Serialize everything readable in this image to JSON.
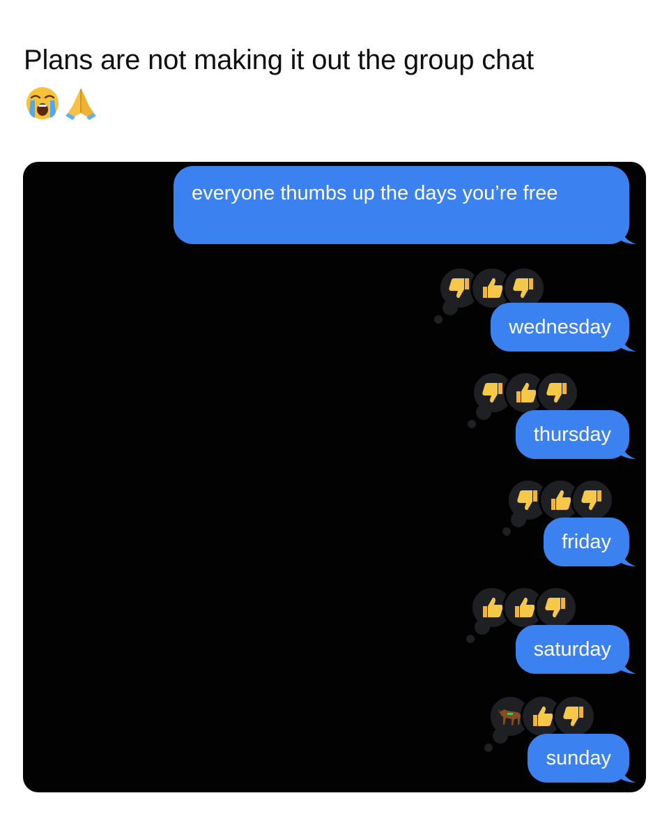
{
  "post": {
    "title": "Plans are not making it out the group chat",
    "title_emojis": [
      "loudly-crying-face-icon",
      "folded-hands-icon"
    ]
  },
  "chat": {
    "background": "#020203",
    "bubble_color": "#3b82f0",
    "question": {
      "text": "everyone thumbs up the days you’re free"
    },
    "days": [
      {
        "label": "wednesday",
        "reactions": [
          "thumbs-down",
          "thumbs-up",
          "thumbs-down"
        ]
      },
      {
        "label": "thursday",
        "reactions": [
          "thumbs-down",
          "thumbs-up",
          "thumbs-down"
        ]
      },
      {
        "label": "friday",
        "reactions": [
          "thumbs-down",
          "thumbs-up",
          "thumbs-down"
        ]
      },
      {
        "label": "saturday",
        "reactions": [
          "thumbs-up",
          "thumbs-up",
          "thumbs-down"
        ]
      },
      {
        "label": "sunday",
        "reactions": [
          "horse",
          "thumbs-up",
          "thumbs-down"
        ]
      }
    ]
  }
}
